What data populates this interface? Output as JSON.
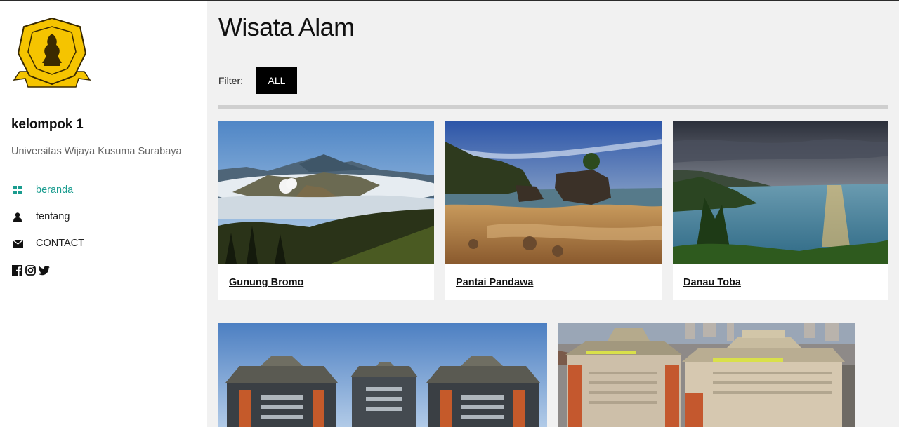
{
  "sidebar": {
    "logo": {
      "text_top": "UNIVERSITAS",
      "text_ring": "WIJAYA KUSUMA SURABAYA",
      "ribbon": "PERSATUAN PENDIDIKAN",
      "colors": {
        "fill": "#f5c400",
        "outline": "#3a2a00"
      }
    },
    "brand": "kelompok 1",
    "subtitle": "Universitas Wijaya Kusuma Surabaya",
    "nav": [
      {
        "label": "beranda",
        "icon": "grid-icon",
        "active": true
      },
      {
        "label": "tentang",
        "icon": "user-icon",
        "active": false
      },
      {
        "label": "CONTACT",
        "icon": "envelope-icon",
        "active": false
      }
    ],
    "social": [
      "facebook-icon",
      "instagram-icon",
      "twitter-icon"
    ]
  },
  "main": {
    "title": "Wisata Alam",
    "filter": {
      "label": "Filter:",
      "button": "ALL"
    },
    "cards": [
      {
        "title": "Gunung Bromo",
        "image": "mountain-volcano-photo"
      },
      {
        "title": "Pantai Pandawa",
        "image": "beach-sunset-photo"
      },
      {
        "title": "Danau Toba",
        "image": "lake-sunset-photo"
      },
      {
        "title": "",
        "image": "university-buildings-photo"
      },
      {
        "title": "",
        "image": "university-campus-aerial-photo"
      }
    ]
  },
  "colors": {
    "accent": "#1a9c8f",
    "page_bg": "#f1f1f1",
    "button_bg": "#000000"
  }
}
